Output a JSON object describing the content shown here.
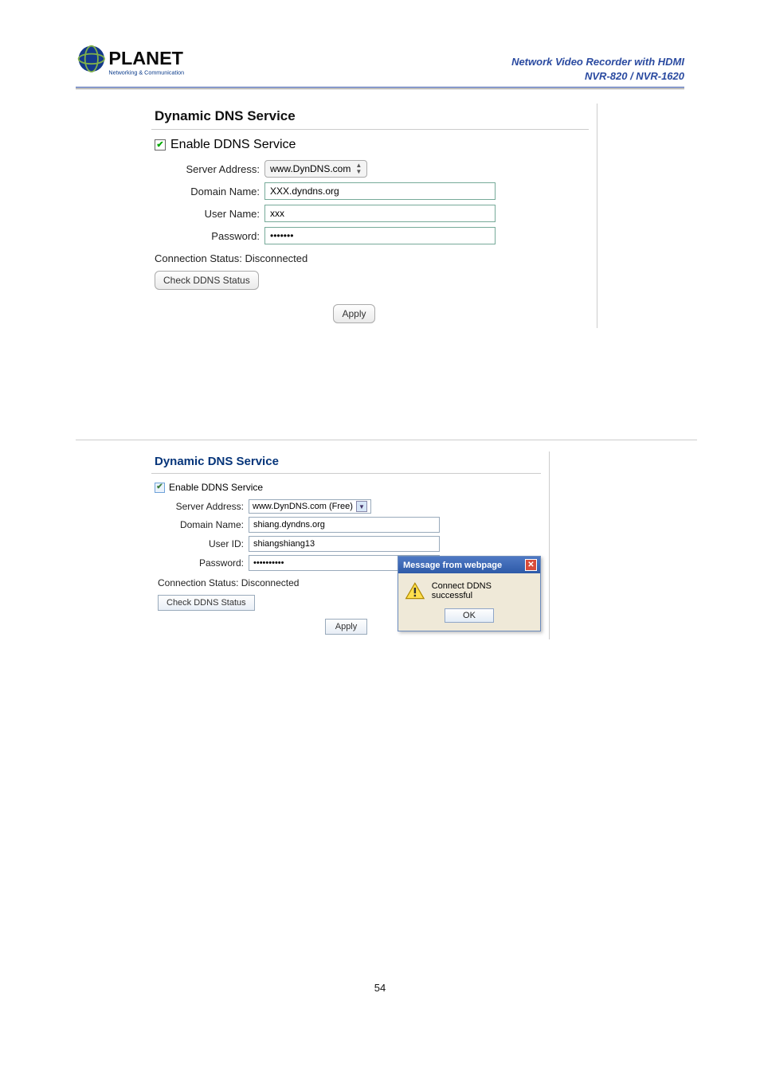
{
  "header": {
    "logo_top": "PLANET",
    "logo_sub": "Networking & Communication",
    "title_line1": "Network Video Recorder with HDMI",
    "title_line2": "NVR-820 / NVR-1620"
  },
  "panel1": {
    "title": "Dynamic DNS Service",
    "enable_label": "Enable DDNS Service",
    "enable_checked": true,
    "server_label": "Server Address:",
    "server_value": "www.DynDNS.com",
    "domain_label": "Domain Name:",
    "domain_value": "XXX.dyndns.org",
    "user_label": "User Name:",
    "user_value": "xxx",
    "password_label": "Password:",
    "password_value": "•••••••",
    "status_prefix": "Connection Status:",
    "status_value": "Disconnected",
    "check_btn": "Check DDNS Status",
    "apply_btn": "Apply"
  },
  "panel2": {
    "title": "Dynamic DNS Service",
    "enable_label": "Enable DDNS Service",
    "enable_checked": true,
    "server_label": "Server Address:",
    "server_value": "www.DynDNS.com (Free)",
    "domain_label": "Domain Name:",
    "domain_value": "shiang.dyndns.org",
    "user_label": "User ID:",
    "user_value": "shiangshiang13",
    "password_label": "Password:",
    "password_value": "••••••••••",
    "status_prefix": "Connection Status:",
    "status_value": "Disconnected",
    "check_btn": "Check DDNS Status",
    "apply_btn": "Apply"
  },
  "dialog": {
    "title": "Message from webpage",
    "body": "Connect DDNS successful",
    "ok": "OK"
  },
  "page_number": "54"
}
